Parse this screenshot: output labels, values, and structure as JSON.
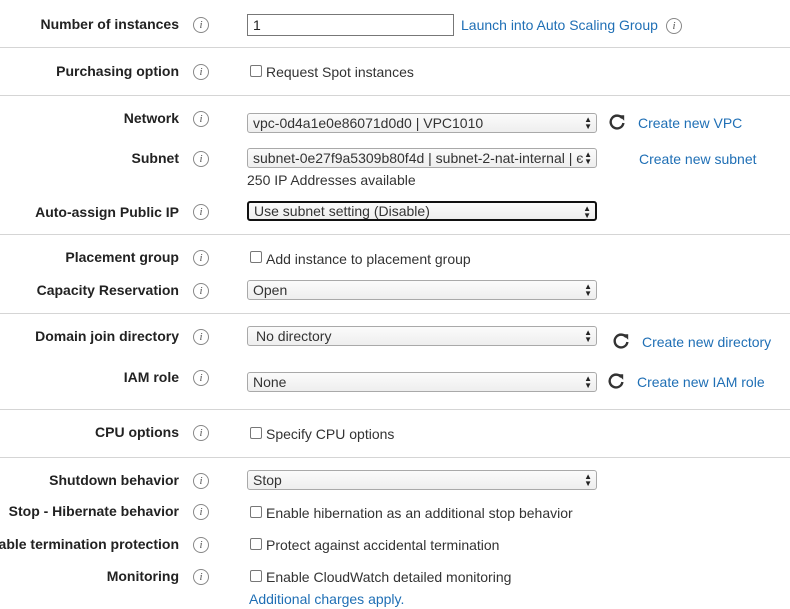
{
  "number_of_instances": {
    "label": "Number of instances",
    "value": "1",
    "asg_link": "Launch into Auto Scaling Group"
  },
  "purchasing_option": {
    "label": "Purchasing option",
    "checkbox_label": "Request Spot instances"
  },
  "network": {
    "label": "Network",
    "value": "vpc-0d4a1e0e86071d0d0 | VPC1010",
    "link": "Create new VPC"
  },
  "subnet": {
    "label": "Subnet",
    "value": "subnet-0e27f9a5309b80f4d | subnet-2-nat-internal | є",
    "link": "Create new subnet",
    "note": "250 IP Addresses available"
  },
  "auto_assign_ip": {
    "label": "Auto-assign Public IP",
    "value": "Use subnet setting (Disable)"
  },
  "placement_group": {
    "label": "Placement group",
    "checkbox_label": "Add instance to placement group"
  },
  "capacity_reservation": {
    "label": "Capacity Reservation",
    "value": "Open"
  },
  "domain_join": {
    "label": "Domain join directory",
    "value": "No directory",
    "link": "Create new directory"
  },
  "iam_role": {
    "label": "IAM role",
    "value": "None",
    "link": "Create new IAM role"
  },
  "cpu_options": {
    "label": "CPU options",
    "checkbox_label": "Specify CPU options"
  },
  "shutdown_behavior": {
    "label": "Shutdown behavior",
    "value": "Stop"
  },
  "stop_hibernate": {
    "label": "Stop - Hibernate behavior",
    "checkbox_label": "Enable hibernation as an additional stop behavior"
  },
  "termination_protection": {
    "label": "Enable termination protection",
    "checkbox_label": "Protect against accidental termination"
  },
  "monitoring": {
    "label": "Monitoring",
    "checkbox_label": "Enable CloudWatch detailed monitoring",
    "note_link": "Additional charges apply."
  },
  "icons": {
    "info": "info-icon",
    "refresh": "refresh-icon",
    "caret": "select-caret-icon"
  },
  "colors": {
    "link": "#1f6fb5",
    "divider": "#d5d5d5"
  }
}
